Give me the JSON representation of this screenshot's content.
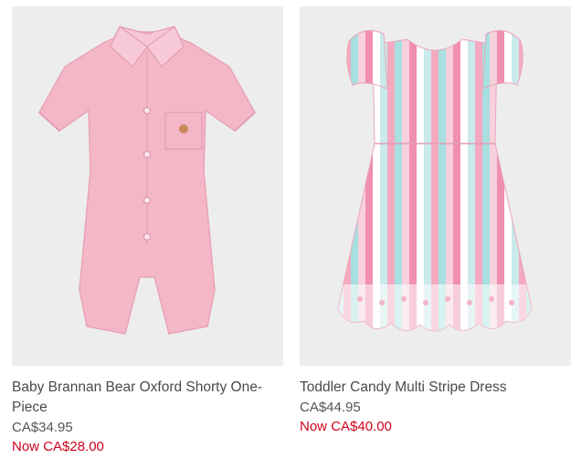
{
  "colors": {
    "sale": "#d0021b",
    "text": "#4a4a4a",
    "image_bg": "#eeeded"
  },
  "products": [
    {
      "name": "Baby Brannan Bear Oxford Shorty One-Piece",
      "original_price": "CA$34.95",
      "sale_prefix": "Now",
      "sale_price": "CA$28.00",
      "image_icon": "pink-romper-image"
    },
    {
      "name": "Toddler Candy Multi Stripe Dress",
      "original_price": "CA$44.95",
      "sale_prefix": "Now",
      "sale_price": "CA$40.00",
      "image_icon": "striped-dress-image"
    }
  ]
}
